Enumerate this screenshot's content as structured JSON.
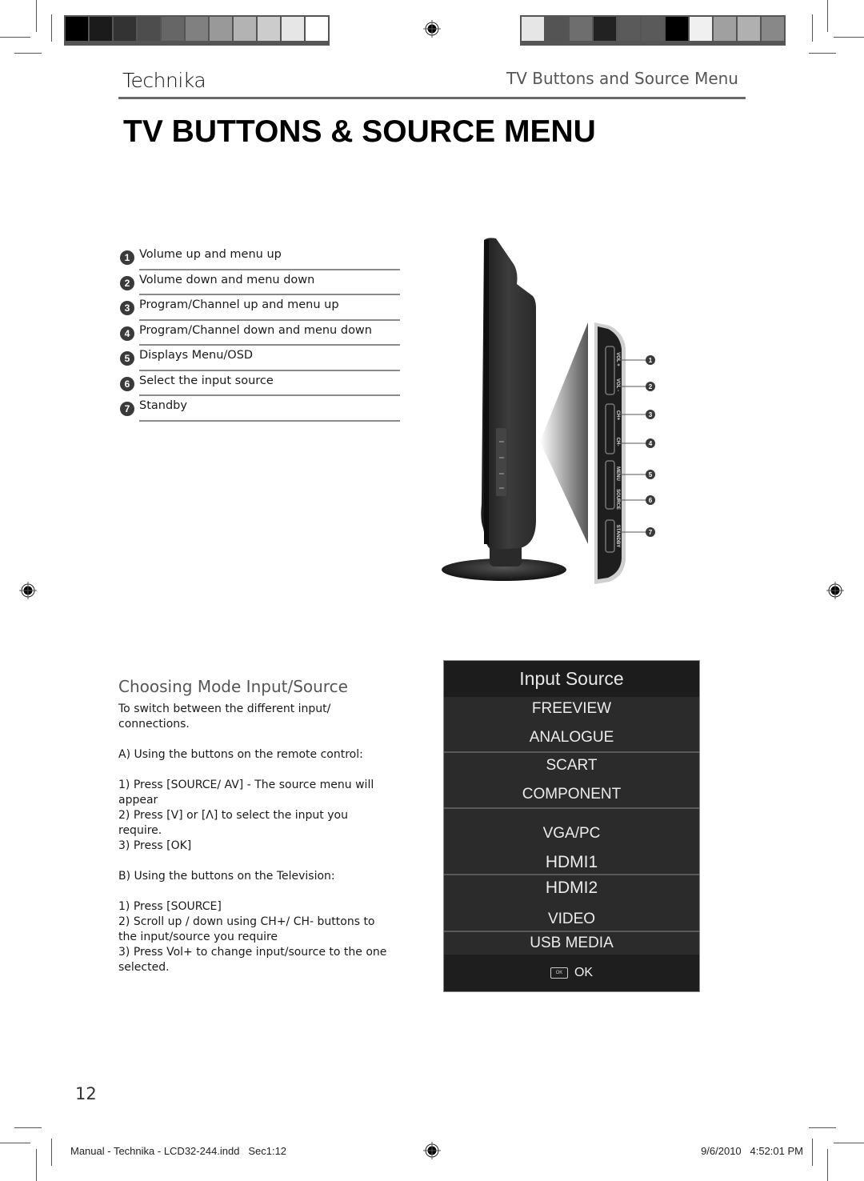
{
  "colors": {
    "swatches_left": [
      "#000000",
      "#1b1b1b",
      "#333333",
      "#4d4d4d",
      "#666666",
      "#808080",
      "#999999",
      "#b3b3b3",
      "#cccccc",
      "#e6e6e6",
      "#ffffff"
    ],
    "swatches_right": [
      "#e6e6e6",
      "#545454",
      "#6e6e6e",
      "#222222",
      "#5a5a5a",
      "#5a5a5a",
      "#000000",
      "#f0f0f0",
      "#a0a0a0",
      "#b0b0b0",
      "#888888"
    ],
    "osd_background": "#2b2b2b",
    "osd_title_background": "#1c1c1c"
  },
  "header": {
    "brand_logo": "Technika",
    "section_title": "TV Buttons and Source Menu",
    "page_title": "TV BUTTONS & SOURCE MENU"
  },
  "buttons_legend": [
    {
      "number": "1",
      "text": "Volume up and menu up"
    },
    {
      "number": "2",
      "text": "Volume down and menu down"
    },
    {
      "number": "3",
      "text": "Program/Channel up and menu up"
    },
    {
      "number": "4",
      "text": "Program/Channel down and menu down"
    },
    {
      "number": "5",
      "text": "Displays Menu/OSD"
    },
    {
      "number": "6",
      "text": "Select the input source"
    },
    {
      "number": "7",
      "text": "Standby"
    }
  ],
  "tv_panel": {
    "button_labels": [
      "VOL +",
      "VOL -",
      "CH+",
      "CH-",
      "MENU",
      "SOURCE",
      "STANDBY"
    ],
    "callouts": [
      "1",
      "2",
      "3",
      "4",
      "5",
      "6",
      "7"
    ]
  },
  "source_section": {
    "heading": "Choosing Mode Input/Source",
    "intro": "To switch between the different input/ connections.",
    "remote_heading": "A) Using the buttons on the remote control:",
    "remote_steps": [
      "1) Press [SOURCE/ AV] - The source menu will appear",
      "2) Press [V] or [Λ] to select the input you require.",
      "3) Press [OK]"
    ],
    "tv_heading": "B) Using the buttons on the Television:",
    "tv_steps": [
      "1) Press [SOURCE]",
      "2) Scroll up / down using CH+/ CH- buttons to the input/source you require",
      "3) Press Vol+ to change input/source to the one selected."
    ]
  },
  "osd_menu": {
    "title": "Input Source",
    "items": [
      "FREEVIEW",
      "ANALOGUE",
      "SCART",
      "COMPONENT",
      "VGA/PC",
      "HDMI1",
      "HDMI2",
      "VIDEO",
      "USB MEDIA"
    ],
    "footer_key": "OK",
    "footer_label": "OK"
  },
  "footer": {
    "page_number": "12",
    "file_info": "Manual - Technika - LCD32-244.indd   Sec1:12",
    "timestamp": "9/6/2010   4:52:01 PM"
  }
}
